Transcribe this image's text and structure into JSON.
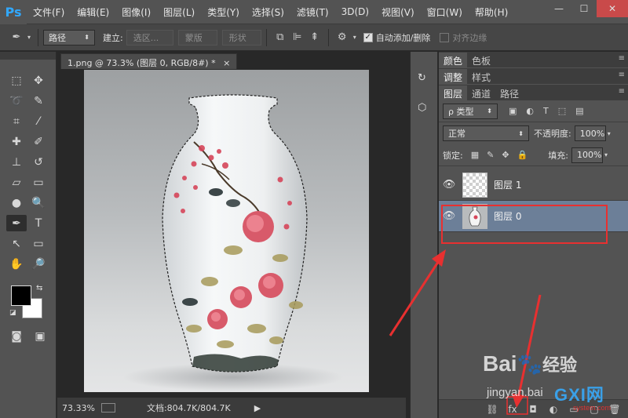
{
  "app": {
    "logo": "Ps"
  },
  "menubar": {
    "items": [
      "文件(F)",
      "编辑(E)",
      "图像(I)",
      "图层(L)",
      "类型(Y)",
      "选择(S)",
      "滤镜(T)",
      "3D(D)",
      "视图(V)",
      "窗口(W)",
      "帮助(H)"
    ],
    "window_buttons": [
      "—",
      "☐",
      "✕"
    ]
  },
  "options_bar": {
    "mode_value": "路径",
    "make_label": "建立:",
    "selection_btn": "选区...",
    "mask_btn": "蒙版",
    "shape_btn": "形状",
    "auto_add_delete_label": "自动添加/删除",
    "auto_add_delete_checked": true,
    "align_edges_label": "对齐边缘",
    "align_edges_checked": false
  },
  "document": {
    "tab_title": "1.png @ 73.3% (图层 0, RGB/8#) *",
    "tab_close": "×",
    "zoom": "73.33%",
    "doc_size": "文档:804.7K/804.7K"
  },
  "panels": {
    "group1_tabs": [
      "颜色",
      "色板"
    ],
    "group2_tabs": [
      "调整",
      "样式"
    ],
    "layers_tabs": [
      "图层",
      "通道",
      "路径"
    ],
    "filter_kind": "ρ 类型",
    "blend_mode": "正常",
    "opacity_label": "不透明度:",
    "opacity_value": "100%",
    "lock_label": "锁定:",
    "fill_label": "填充:",
    "fill_value": "100%",
    "layers": [
      {
        "name": "图层 1",
        "selected": false,
        "thumb": "transparent"
      },
      {
        "name": "图层 0",
        "selected": true,
        "thumb": "vase"
      }
    ]
  },
  "watermarks": {
    "baidu": "Bai",
    "jingyan": "经验",
    "jingyan_url": "jingyan.bai",
    "gxi": "GXI网",
    "gxi_url": "system.com"
  },
  "colors": {
    "highlight_red": "#e83030",
    "selected_layer": "#6c7f98",
    "ps_blue": "#31a8ff"
  }
}
